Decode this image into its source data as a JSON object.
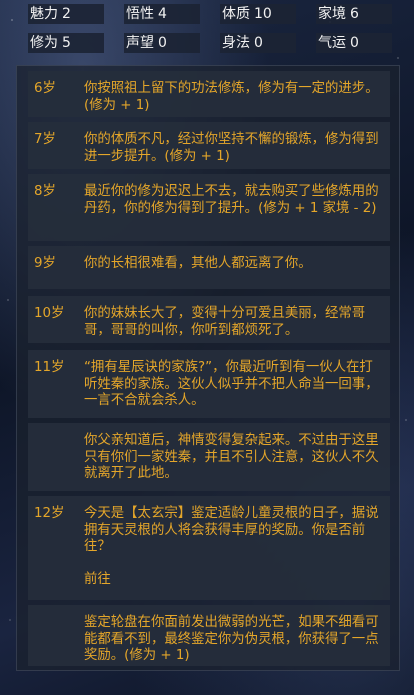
{
  "stats": [
    {
      "label": "魅力",
      "value": "2"
    },
    {
      "label": "悟性",
      "value": "4"
    },
    {
      "label": "体质",
      "value": "10"
    },
    {
      "label": "家境",
      "value": "6"
    },
    {
      "label": "修为",
      "value": "5"
    },
    {
      "label": "声望",
      "value": "0"
    },
    {
      "label": "身法",
      "value": "0"
    },
    {
      "label": "气运",
      "value": "0"
    }
  ],
  "log": [
    {
      "age": "6岁",
      "lines": [
        "你按照祖上留下的功法修炼，修为有一定的进步。(修为 + 1)"
      ]
    },
    {
      "age": "7岁",
      "lines": [
        "你的体质不凡，经过你坚持不懈的锻炼，修为得到进一步提升。(修为 + 1)"
      ]
    },
    {
      "age": "8岁",
      "lines": [
        "最近你的修为迟迟上不去，就去购买了些修炼用的丹药，你的修为得到了提升。(修为 + 1 家境 - 2)"
      ]
    },
    {
      "age": "9岁",
      "lines": [
        "你的长相很难看，其他人都远离了你。"
      ]
    },
    {
      "age": "10岁",
      "lines": [
        "你的妹妹长大了，变得十分可爱且美丽，经常哥哥，哥哥的叫你，你听到都烦死了。"
      ]
    },
    {
      "age": "11岁",
      "lines": [
        "“拥有星辰诀的家族?”，你最近听到有一伙人在打听姓秦的家族。这伙人似乎并不把人命当一回事，一言不合就会杀人。"
      ]
    },
    {
      "age": "",
      "lines": [
        "你父亲知道后，神情变得复杂起来。不过由于这里只有你们一家姓秦，并且不引人注意，这伙人不久就离开了此地。"
      ]
    },
    {
      "age": "12岁",
      "lines": [
        "今天是【太玄宗】鉴定适龄儿童灵根的日子，据说拥有天灵根的人将会获得丰厚的奖励。你是否前往？",
        "前往"
      ]
    },
    {
      "age": "",
      "lines": [
        "鉴定轮盘在你面前发出微弱的光芒，如果不细看可能都看不到，最终鉴定你为伪灵根，你获得了一点奖励。(修为 + 1)"
      ]
    }
  ]
}
